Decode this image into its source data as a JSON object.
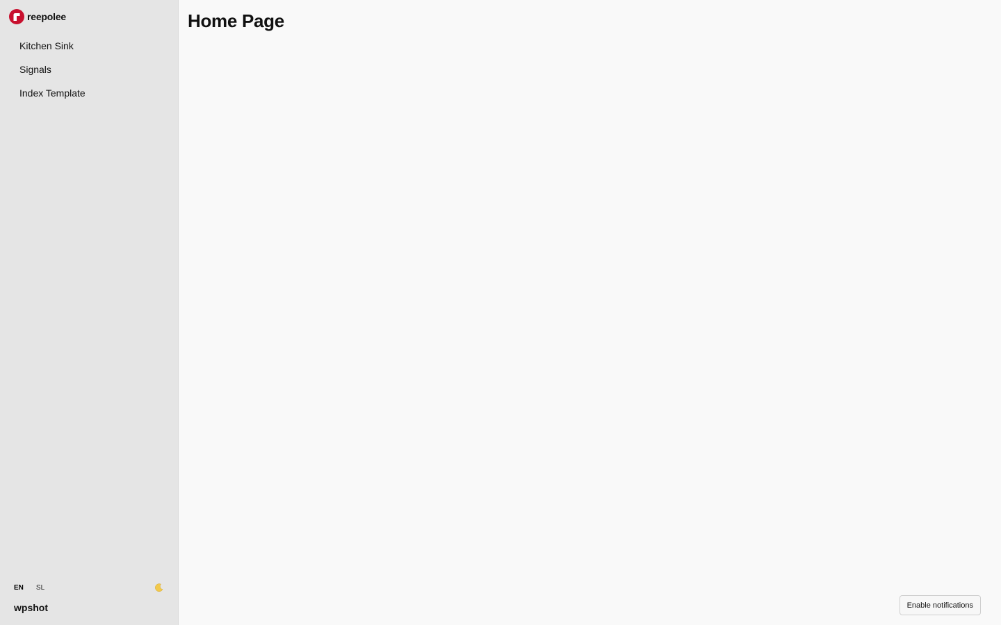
{
  "brand": {
    "name": "reepolee",
    "color": "#c8102e"
  },
  "sidebar": {
    "items": [
      {
        "label": "Kitchen Sink"
      },
      {
        "label": "Signals"
      },
      {
        "label": "Index Template"
      }
    ],
    "languages": [
      {
        "label": "EN",
        "active": true
      },
      {
        "label": "SL",
        "active": false
      }
    ],
    "theme_icon": "moon-icon",
    "user_name": "wpshot"
  },
  "main": {
    "title": "Home Page",
    "notify_button_label": "Enable notifications"
  }
}
